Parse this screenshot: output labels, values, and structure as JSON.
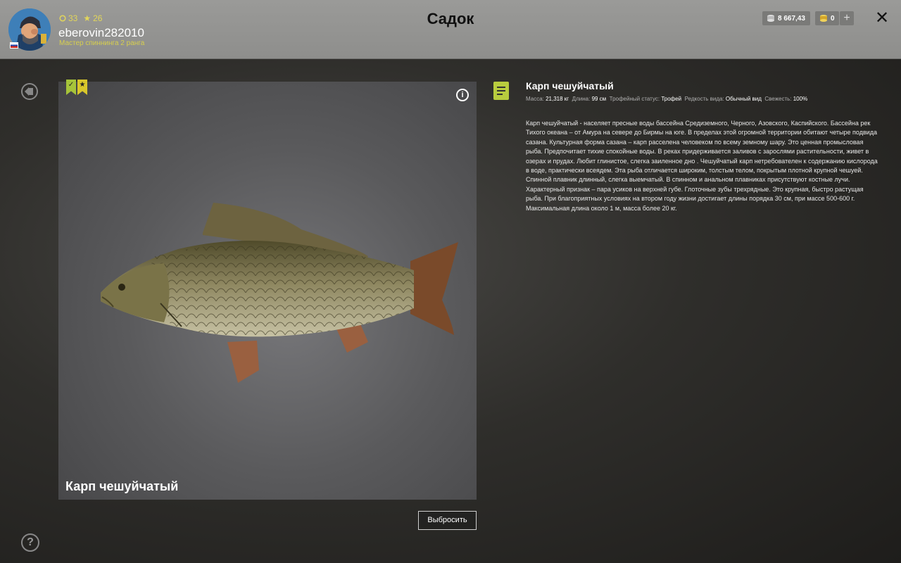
{
  "header": {
    "title": "Садок",
    "level": "33",
    "stars": "26",
    "username": "eberovin282010",
    "rank": "Мастер спиннинга 2 ранга",
    "silver": "8 667,43",
    "gold": "0",
    "add_label": "+",
    "close_label": "✕"
  },
  "fish": {
    "name": "Карп чешуйчатый",
    "info_label": "i",
    "discard_label": "Выбросить",
    "props": {
      "mass_label": "Масса:",
      "mass": "21,318 кг",
      "length_label": "Длина:",
      "length": "99 см",
      "trophy_label": "Трофейный статус:",
      "trophy": "Трофей",
      "rarity_label": "Редкость вида:",
      "rarity": "Обычный вид",
      "fresh_label": "Свежесть:",
      "fresh": "100%"
    },
    "description": "Карп чешуйчатый - населяет пресные воды бассейна Средиземного, Черного, Азовского, Каспийского. Бассейна рек Тихого океана – от Амура на севере до Бирмы на юге. В пределах этой огромной территории обитают четыре подвида сазана. Культурная форма сазана – карп расселена человеком по всему земному шару. Это ценная промысловая рыба. Предпочитает тихие спокойные воды. В реках придерживается заливов с зарослями растительности, живет в озерах и прудах. Любит глинистое, слегка заиленное дно . Чешуйчатый карп нетребователен к содержанию кислорода в воде, практически всеядем. Эта рыба отличается широким, толстым телом, покрытым плотной крупной чешуей. Спинной плавник длинный, слегка выемчатый. В спинном и анальном плавниках присутствуют костные лучи. Характерный признак – пара усиков на верхней губе. Глоточные зубы трехрядные. Это крупная, быстро растущая рыба. При благоприятных условиях на втором году жизни достигает длины порядка 30 см, при массе 500-600 г. Максимальная длина около 1 м, масса более 20 кг."
  },
  "help_label": "?"
}
